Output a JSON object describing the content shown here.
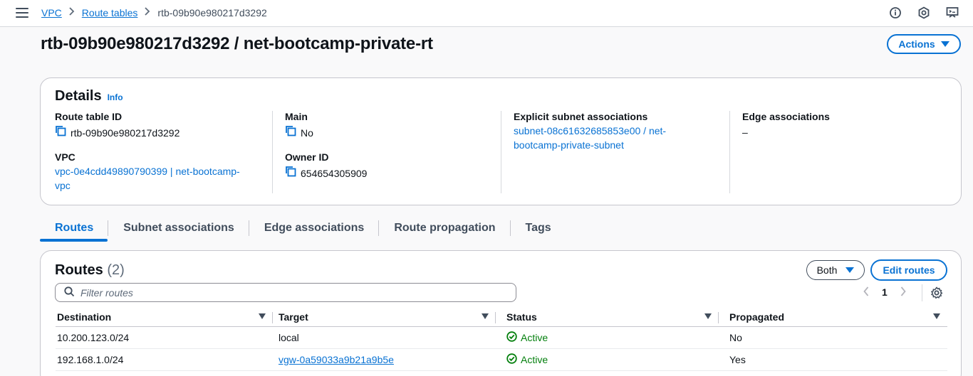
{
  "breadcrumb": {
    "vpc": "VPC",
    "route_tables": "Route tables",
    "current": "rtb-09b90e980217d3292"
  },
  "page": {
    "title": "rtb-09b90e980217d3292 / net-bootcamp-private-rt",
    "actions_label": "Actions"
  },
  "details": {
    "heading": "Details",
    "info_label": "Info",
    "route_table_id_label": "Route table ID",
    "route_table_id": "rtb-09b90e980217d3292",
    "vpc_label": "VPC",
    "vpc_value_line1": "vpc-0e4cdd49890790399 | net-bootcamp-",
    "vpc_value_line2": "vpc",
    "main_label": "Main",
    "main_value": "No",
    "owner_id_label": "Owner ID",
    "owner_id": "654654305909",
    "explicit_label": "Explicit subnet associations",
    "explicit_line1": "subnet-08c61632685853e00 / net-",
    "explicit_line2": "bootcamp-private-subnet",
    "edge_label": "Edge associations",
    "edge_value": "–"
  },
  "tabs": [
    "Routes",
    "Subnet associations",
    "Edge associations",
    "Route propagation",
    "Tags"
  ],
  "routes": {
    "heading": "Routes",
    "count": "(2)",
    "filter_label": "Both",
    "edit_label": "Edit routes",
    "search_placeholder": "Filter routes",
    "page_number": "1",
    "columns": [
      "Destination",
      "Target",
      "Status",
      "Propagated"
    ],
    "rows": [
      {
        "destination": "10.200.123.0/24",
        "target": "local",
        "status": "Active",
        "propagated": "No"
      },
      {
        "destination": "192.168.1.0/24",
        "target": "vgw-0a59033a9b21a9b5e",
        "status": "Active",
        "propagated": "Yes"
      }
    ]
  },
  "colors": {
    "link": "#0972d3",
    "success": "#037f0c",
    "text": "#0f141a",
    "border": "#c6c6cd"
  },
  "icons": [
    "menu-icon",
    "chevron-right-icon",
    "info-circle-icon",
    "notification-icon",
    "feedback-icon",
    "copy-icon",
    "caret-down-icon",
    "search-icon",
    "chevron-left-icon",
    "settings-gear-icon",
    "status-check-icon"
  ]
}
